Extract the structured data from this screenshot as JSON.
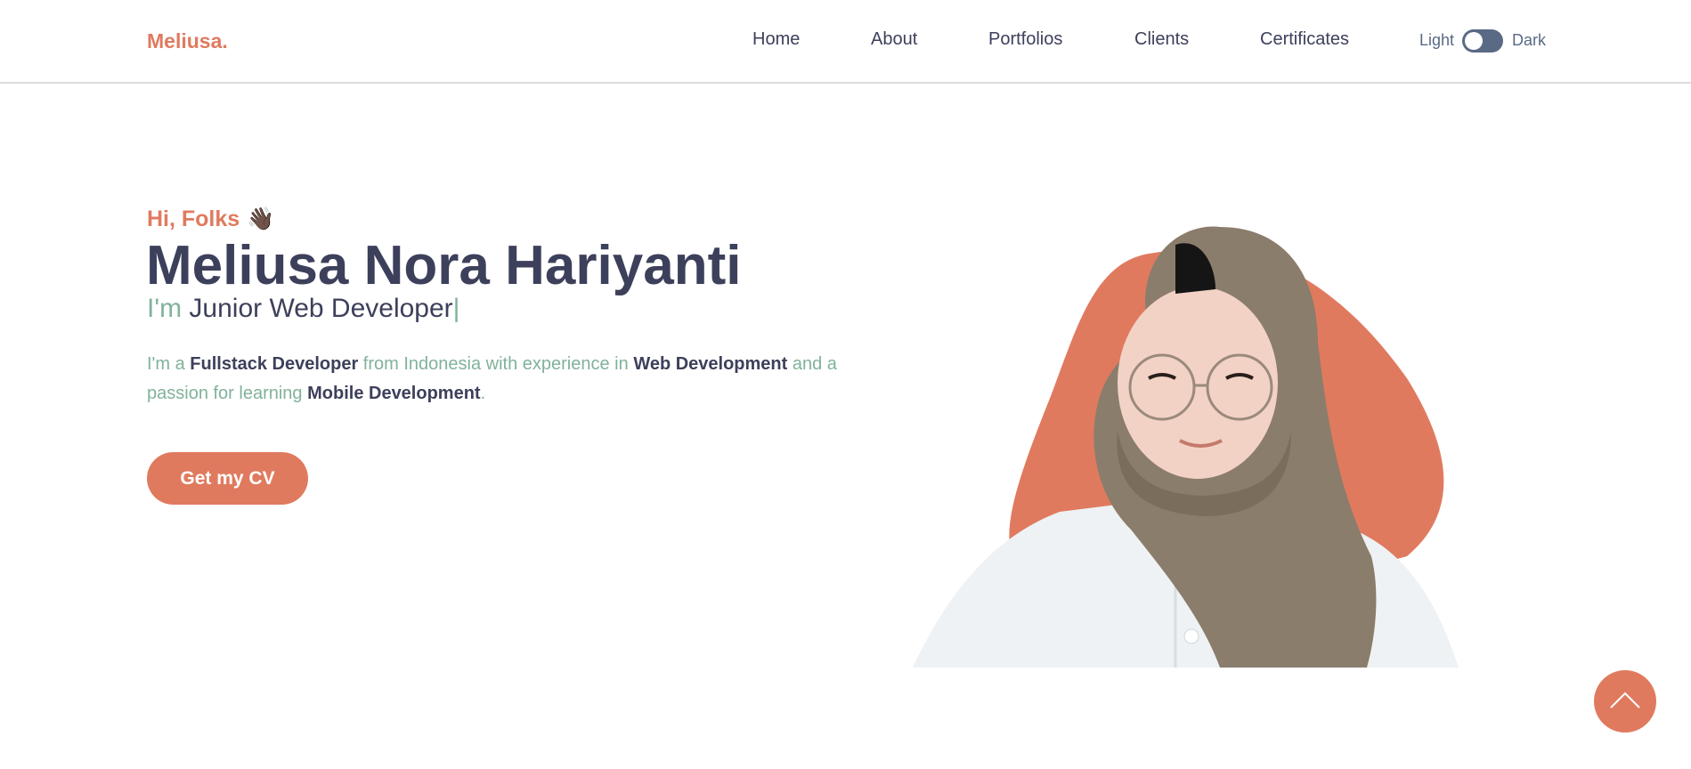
{
  "header": {
    "logo": "Meliusa.",
    "nav": [
      {
        "label": "Home"
      },
      {
        "label": "About"
      },
      {
        "label": "Portfolios"
      },
      {
        "label": "Clients"
      },
      {
        "label": "Certificates"
      }
    ],
    "theme_toggle": {
      "light_label": "Light",
      "dark_label": "Dark",
      "state": "light"
    }
  },
  "hero": {
    "greeting": "Hi, Folks",
    "greeting_emoji": "👋🏿",
    "name": "Meliusa Nora Hariyanti",
    "role_prefix": "I'm",
    "role": "Junior Web Developer",
    "cursor": "|",
    "description": {
      "t1": "I'm a ",
      "b1": "Fullstack Developer",
      "t2": " from Indonesia with experience in ",
      "b2": "Web Development",
      "t3": " and a passion for learning ",
      "b3": "Mobile Development",
      "t4": "."
    },
    "cv_button": "Get my CV"
  },
  "icons": {
    "wave": "waving-hand-icon",
    "scroll_top": "chevron-up-icon"
  },
  "colors": {
    "accent": "#e07a5f",
    "dark": "#3d405b",
    "muted_green": "#81b29a",
    "toggle": "#5a6a85"
  }
}
